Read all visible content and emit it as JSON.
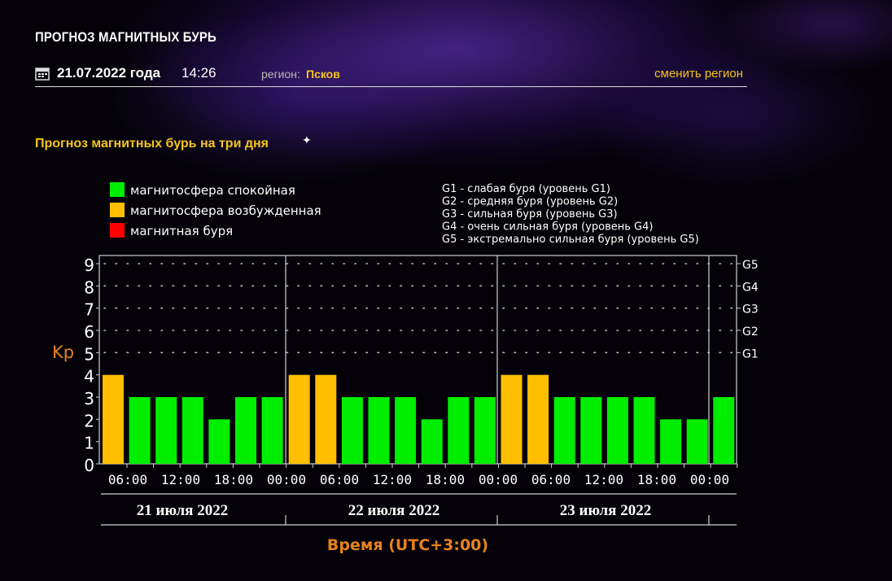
{
  "header": {
    "title": "ПРОГНОЗ МАГНИТНЫХ БУРЬ",
    "date": "21.07.2022 года",
    "time": "14:26",
    "region_label": "регион:",
    "region_name": "Псков",
    "change_region": "сменить регион"
  },
  "section_title": "Прогноз магнитных бурь на три дня",
  "colors": {
    "calm": "#00ee00",
    "excited": "#ffbf00",
    "storm": "#ff0000",
    "accent": "#f5c518",
    "axis_title": "#e8821e"
  },
  "legend": {
    "items": [
      {
        "label": "магнитосфера спокойная",
        "color": "#00ee00"
      },
      {
        "label": "магнитосфера возбужденная",
        "color": "#ffbf00"
      },
      {
        "label": "магнитная буря",
        "color": "#ff0000"
      }
    ],
    "levels": [
      "G1 - слабая буря (уровень G1)",
      "G2 - средняя буря (уровень G2)",
      "G3 - сильная буря (уровень G3)",
      "G4 - очень сильная буря (уровень G4)",
      "G5 - экстремально сильная буря (уровень G5)"
    ]
  },
  "chart_data": {
    "type": "bar",
    "ylabel": "Kp",
    "xlabel": "Время (UTC+3:00)",
    "ylim": [
      0,
      9
    ],
    "yticks": [
      "0",
      "1",
      "2",
      "3",
      "4",
      "5",
      "6",
      "7",
      "8",
      "9"
    ],
    "right_ticks": [
      {
        "kp": 5,
        "label": "G1"
      },
      {
        "kp": 6,
        "label": "G2"
      },
      {
        "kp": 7,
        "label": "G3"
      },
      {
        "kp": 8,
        "label": "G4"
      },
      {
        "kp": 9,
        "label": "G5"
      }
    ],
    "xticks": [
      "06:00",
      "12:00",
      "18:00",
      "00:00",
      "06:00",
      "12:00",
      "18:00",
      "00:00",
      "06:00",
      "12:00",
      "18:00",
      "00:00"
    ],
    "days": [
      "21 июля 2022",
      "22 июля 2022",
      "23 июля 2022"
    ],
    "grid": true,
    "values": [
      4,
      3,
      3,
      3,
      2,
      3,
      3,
      4,
      4,
      3,
      3,
      3,
      2,
      3,
      3,
      4,
      4,
      3,
      3,
      3,
      3,
      2,
      2,
      3
    ],
    "status": [
      "excited",
      "calm",
      "calm",
      "calm",
      "calm",
      "calm",
      "calm",
      "excited",
      "excited",
      "calm",
      "calm",
      "calm",
      "calm",
      "calm",
      "calm",
      "excited",
      "excited",
      "calm",
      "calm",
      "calm",
      "calm",
      "calm",
      "calm",
      "calm"
    ]
  }
}
